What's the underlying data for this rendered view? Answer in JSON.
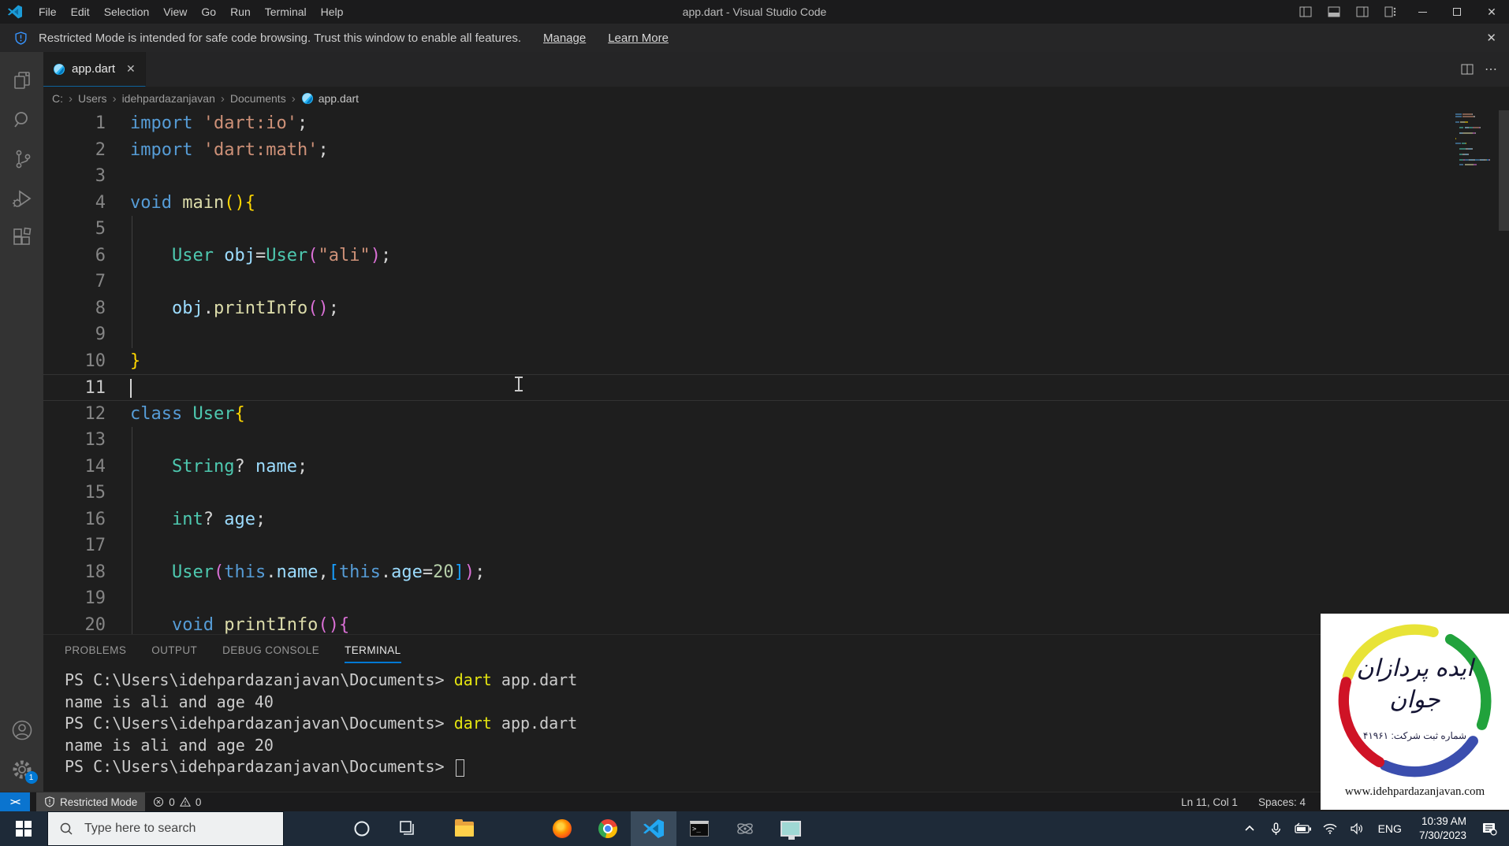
{
  "window": {
    "title": "app.dart - Visual Studio Code"
  },
  "menubar": {
    "items": [
      "File",
      "Edit",
      "Selection",
      "View",
      "Go",
      "Run",
      "Terminal",
      "Help"
    ]
  },
  "banner": {
    "text": "Restricted Mode is intended for safe code browsing. Trust this window to enable all features.",
    "manage": "Manage",
    "learn_more": "Learn More"
  },
  "tab": {
    "label": "app.dart"
  },
  "breadcrumb": {
    "items": [
      "C:",
      "Users",
      "idehpardazanjavan",
      "Documents"
    ],
    "file": "app.dart"
  },
  "editor": {
    "palette": {
      "kw": "#569CD6",
      "type": "#4EC9B0",
      "fn": "#DCDCAA",
      "str": "#CE9178",
      "num": "#B5CEA8",
      "var": "#9CDCFE",
      "plain": "#D4D4D4",
      "b1": "#FFD700",
      "b2": "#DA70D6",
      "b3": "#179FFF"
    },
    "lines": [
      {
        "n": 1,
        "tokens": [
          [
            "kw",
            "import"
          ],
          [
            "plain",
            " "
          ],
          [
            "str",
            "'dart:io'"
          ],
          [
            "plain",
            ";"
          ]
        ]
      },
      {
        "n": 2,
        "tokens": [
          [
            "kw",
            "import"
          ],
          [
            "plain",
            " "
          ],
          [
            "str",
            "'dart:math'"
          ],
          [
            "plain",
            ";"
          ]
        ]
      },
      {
        "n": 3,
        "tokens": []
      },
      {
        "n": 4,
        "tokens": [
          [
            "kw",
            "void"
          ],
          [
            "plain",
            " "
          ],
          [
            "fn",
            "main"
          ],
          [
            "b1",
            "("
          ],
          [
            "b1",
            ")"
          ],
          [
            "b1",
            "{"
          ]
        ]
      },
      {
        "n": 5,
        "tokens": []
      },
      {
        "n": 6,
        "tokens": [
          [
            "plain",
            "    "
          ],
          [
            "type",
            "User"
          ],
          [
            "plain",
            " "
          ],
          [
            "var",
            "obj"
          ],
          [
            "plain",
            "="
          ],
          [
            "type",
            "User"
          ],
          [
            "b2",
            "("
          ],
          [
            "str",
            "\"ali\""
          ],
          [
            "b2",
            ")"
          ],
          [
            "plain",
            ";"
          ]
        ]
      },
      {
        "n": 7,
        "tokens": []
      },
      {
        "n": 8,
        "tokens": [
          [
            "plain",
            "    "
          ],
          [
            "var",
            "obj"
          ],
          [
            "plain",
            "."
          ],
          [
            "fn",
            "printInfo"
          ],
          [
            "b2",
            "("
          ],
          [
            "b2",
            ")"
          ],
          [
            "plain",
            ";"
          ]
        ]
      },
      {
        "n": 9,
        "tokens": []
      },
      {
        "n": 10,
        "tokens": [
          [
            "b1",
            "}"
          ]
        ]
      },
      {
        "n": 11,
        "tokens": [],
        "current": true,
        "cursor": true
      },
      {
        "n": 12,
        "tokens": [
          [
            "kw",
            "class"
          ],
          [
            "plain",
            " "
          ],
          [
            "type",
            "User"
          ],
          [
            "b1",
            "{"
          ]
        ]
      },
      {
        "n": 13,
        "tokens": []
      },
      {
        "n": 14,
        "tokens": [
          [
            "plain",
            "    "
          ],
          [
            "type",
            "String"
          ],
          [
            "plain",
            "? "
          ],
          [
            "var",
            "name"
          ],
          [
            "plain",
            ";"
          ]
        ]
      },
      {
        "n": 15,
        "tokens": []
      },
      {
        "n": 16,
        "tokens": [
          [
            "plain",
            "    "
          ],
          [
            "type",
            "int"
          ],
          [
            "plain",
            "? "
          ],
          [
            "var",
            "age"
          ],
          [
            "plain",
            ";"
          ]
        ]
      },
      {
        "n": 17,
        "tokens": []
      },
      {
        "n": 18,
        "tokens": [
          [
            "plain",
            "    "
          ],
          [
            "type",
            "User"
          ],
          [
            "b2",
            "("
          ],
          [
            "kw",
            "this"
          ],
          [
            "plain",
            "."
          ],
          [
            "var",
            "name"
          ],
          [
            "plain",
            ","
          ],
          [
            "b3",
            "["
          ],
          [
            "kw",
            "this"
          ],
          [
            "plain",
            "."
          ],
          [
            "var",
            "age"
          ],
          [
            "plain",
            "="
          ],
          [
            "num",
            "20"
          ],
          [
            "b3",
            "]"
          ],
          [
            "b2",
            ")"
          ],
          [
            "plain",
            ";"
          ]
        ]
      },
      {
        "n": 19,
        "tokens": []
      },
      {
        "n": 20,
        "tokens": [
          [
            "plain",
            "    "
          ],
          [
            "kw",
            "void"
          ],
          [
            "plain",
            " "
          ],
          [
            "fn",
            "printInfo"
          ],
          [
            "b2",
            "("
          ],
          [
            "b2",
            ")"
          ],
          [
            "b2",
            "{"
          ]
        ]
      }
    ]
  },
  "panel": {
    "tabs": [
      "PROBLEMS",
      "OUTPUT",
      "DEBUG CONSOLE",
      "TERMINAL"
    ],
    "active": "TERMINAL",
    "terminal": {
      "palette": {
        "plain": "#CCCCCC",
        "cmd": "#E5E510"
      },
      "lines": [
        {
          "tokens": [
            [
              "plain",
              "PS C:\\Users\\idehpardazanjavan\\Documents> "
            ],
            [
              "cmd",
              "dart"
            ],
            [
              "plain",
              " app.dart"
            ]
          ]
        },
        {
          "tokens": [
            [
              "plain",
              "name is ali and age 40"
            ]
          ]
        },
        {
          "tokens": [
            [
              "plain",
              "PS C:\\Users\\idehpardazanjavan\\Documents> "
            ],
            [
              "cmd",
              "dart"
            ],
            [
              "plain",
              " app.dart"
            ]
          ]
        },
        {
          "tokens": [
            [
              "plain",
              "name is ali and age 20"
            ]
          ]
        },
        {
          "tokens": [
            [
              "plain",
              "PS C:\\Users\\idehpardazanjavan\\Documents> "
            ]
          ],
          "cursor": true
        }
      ]
    }
  },
  "statusbar": {
    "restricted": "Restricted Mode",
    "errors": "0",
    "warnings": "0",
    "line_col": "Ln 11, Col 1",
    "spaces": "Spaces: 4"
  },
  "taskbar": {
    "search_placeholder": "Type here to search",
    "language": "ENG",
    "time": "10:39 AM",
    "date": "7/30/2023"
  },
  "watermark": {
    "line1": "ایده پردازان",
    "line2": "جوان",
    "registration": "شماره ثبت شرکت: ۴۱۹۶۱",
    "url": "www.idehpardazanjavan.com",
    "colors": {
      "yellow": "#e8e337",
      "green": "#21a23c",
      "red": "#cf1326",
      "blue": "#3b4eae"
    }
  }
}
